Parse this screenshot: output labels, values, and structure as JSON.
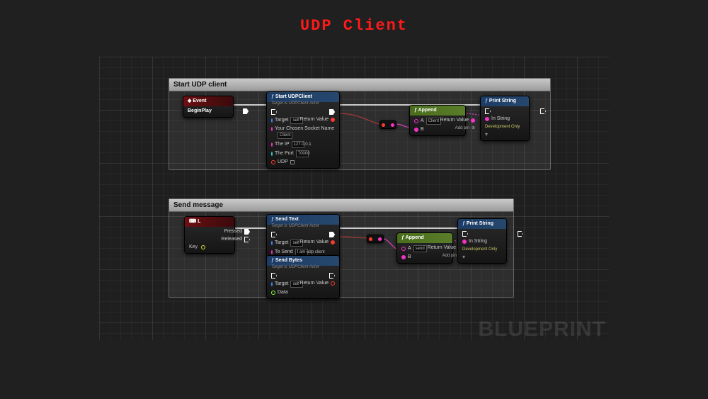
{
  "title": "UDP Client",
  "watermark": "BLUEPRINT",
  "colors": {
    "exec": "#ffffff",
    "string": "#ff33cc",
    "bool": "#ff3b30",
    "object": "#3b8cff",
    "int": "#2bd6d6"
  },
  "comments": {
    "start": {
      "title": "Start UDP client"
    },
    "send": {
      "title": "Send message"
    }
  },
  "nodes": {
    "beginPlay": {
      "title": "Event BeginPlay"
    },
    "startClient": {
      "title": "Start UDPClient",
      "subtitle": "Target is UDPClient Actor",
      "pins": {
        "target": "Target",
        "target_val": "self",
        "socketName": "Your Chosen Socket Name",
        "socketName_val": "Client",
        "ip": "The IP",
        "ip_val": "127.0.0.1",
        "port": "The Port",
        "port_val": "70000",
        "udp": "UDP",
        "return": "Return Value"
      }
    },
    "append1": {
      "title": "Append",
      "pins": {
        "a": "A",
        "a_val": "Client",
        "b": "B",
        "return": "Return Value",
        "addpin": "Add pin"
      }
    },
    "print1": {
      "title": "Print String",
      "pins": {
        "inString": "In String",
        "dev": "Development Only"
      }
    },
    "inputL": {
      "title": "L",
      "pins": {
        "pressed": "Pressed",
        "released": "Released",
        "key": "Key"
      }
    },
    "sendText": {
      "title": "Send Text",
      "subtitle": "Target is UDPClient Actor",
      "pins": {
        "target": "Target",
        "target_val": "self",
        "toSend": "To Send",
        "toSend_val": "I am udp client",
        "return": "Return Value"
      }
    },
    "sendBytes": {
      "title": "Send Bytes",
      "subtitle": "Target is UDPClient Actor",
      "pins": {
        "target": "Target",
        "target_val": "self",
        "data": "Data",
        "return": "Return Value"
      }
    },
    "append2": {
      "title": "Append",
      "pins": {
        "a": "A",
        "a_val": "send",
        "b": "B",
        "return": "Return Value",
        "addpin": "Add pin"
      }
    },
    "print2": {
      "title": "Print String",
      "pins": {
        "inString": "In String",
        "dev": "Development Only"
      }
    }
  }
}
